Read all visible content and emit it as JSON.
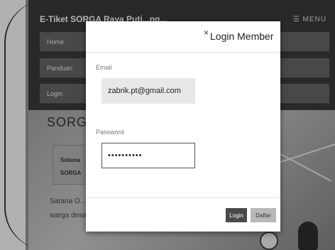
{
  "site": {
    "brand": "E-Tiket SORGA Raya Puti...ng...",
    "menu_label": "☰ MENU",
    "nav": [
      {
        "label": "Home"
      },
      {
        "label": "Panduan"
      },
      {
        "label": "Login"
      }
    ],
    "heading": "SORGA",
    "info_line1": "Selama",
    "info_line2": "SORGA",
    "paragraph": "Sarana O... ini meru... olahraga yang dipergunakan oleh warga desa sarana ini untuk olah raga Futsal dan Volley"
  },
  "modal": {
    "close_glyph": "×",
    "title": "Login Member",
    "email_label": "Email",
    "email_value": "zabrik.pt@gmail.com",
    "password_label": "Password",
    "password_value": "••••••••••",
    "login_button": "Login",
    "daftar_button": "Daftar"
  }
}
